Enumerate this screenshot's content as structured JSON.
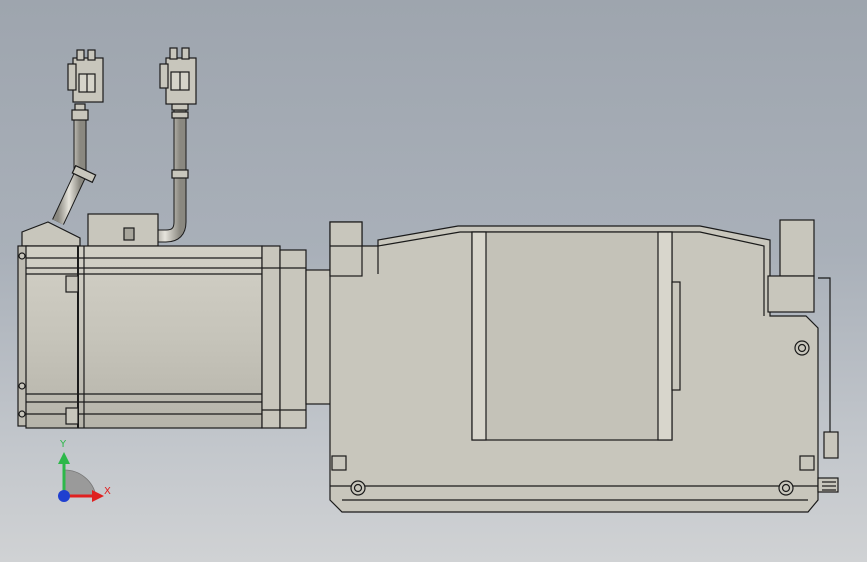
{
  "viewport": {
    "background_top": "#9ea5ae",
    "background_bottom": "#d0d2d4",
    "part_fill": "#c8c6bc",
    "part_shade": "#b4b2a8",
    "edge_color": "#1a1a1a",
    "dark_fill": "#5e5c56"
  },
  "triad": {
    "y_label": "Y",
    "x_label": "X",
    "y_color": "#2db84a",
    "x_color": "#e02020",
    "z_color": "#1f3fd0"
  }
}
